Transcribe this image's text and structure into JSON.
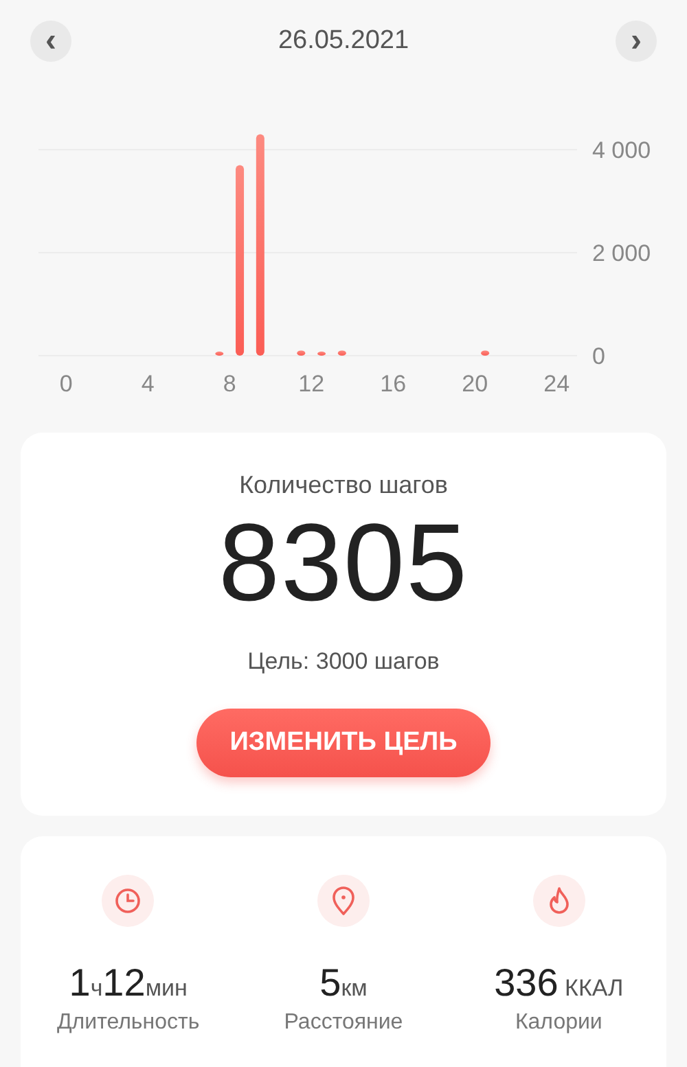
{
  "header": {
    "date": "26.05.2021",
    "prev": "‹",
    "next": "›"
  },
  "chart": {
    "chart_data": {
      "type": "bar",
      "x": [
        7.5,
        8.5,
        9.5,
        11.5,
        12.5,
        13.5,
        20.5
      ],
      "values": [
        50,
        3700,
        4300,
        100,
        50,
        100,
        100
      ],
      "xlim": [
        -1.35,
        25
      ],
      "ylim": [
        0,
        4300
      ],
      "xticks": [
        0,
        4,
        8,
        12,
        16,
        20,
        24
      ],
      "yticks": [
        {
          "value": 0,
          "label": "0"
        },
        {
          "value": 2000,
          "label": "2 000"
        },
        {
          "value": 4000,
          "label": "4 000"
        }
      ]
    }
  },
  "steps_card": {
    "title": "Количество шагов",
    "count": "8305",
    "goal": "Цель: 3000 шагов",
    "button": "ИЗМЕНИТЬ ЦЕЛЬ"
  },
  "stats": [
    {
      "kind": "clock",
      "value": "1ч12мин",
      "label": "Длительность"
    },
    {
      "kind": "pin",
      "value": "5км",
      "label": "Расстояние"
    },
    {
      "kind": "flame",
      "value": "336 ККАЛ",
      "label": "Калории"
    }
  ]
}
